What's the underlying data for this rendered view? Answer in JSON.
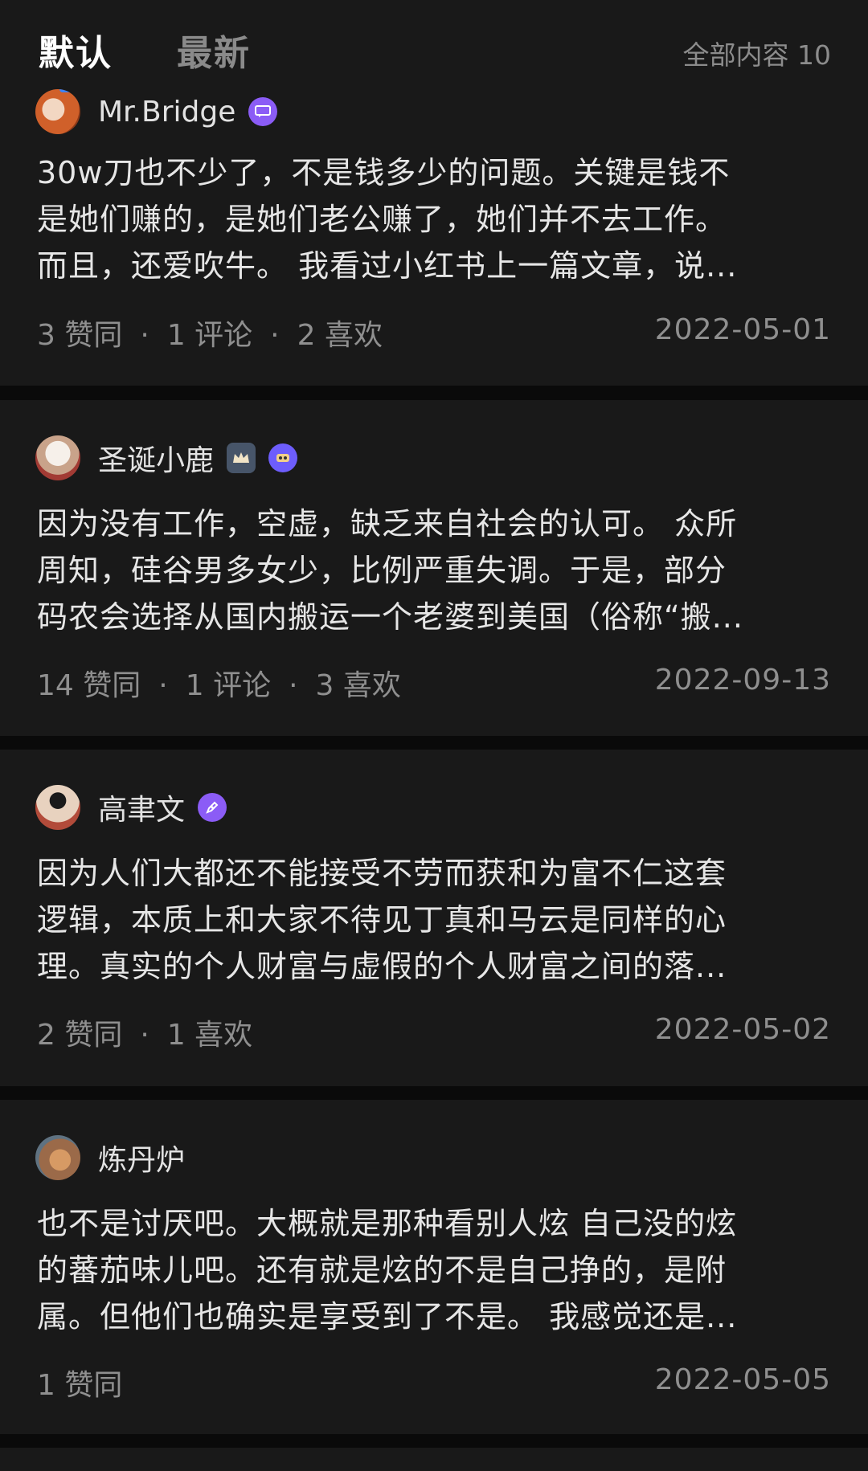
{
  "tabs": {
    "default_label": "默认",
    "latest_label": "最新",
    "total_label": "全部内容 10"
  },
  "answers": [
    {
      "username": "Mr.Bridge",
      "lines": [
        "30w刀也不少了，不是钱多少的问题。关键是钱不",
        "是她们赚的，是她们老公赚了，她们并不去工作。",
        "而且，还爱吹牛。 我看过小红书上一篇文章，说..."
      ],
      "stats": [
        "3 赞同",
        "1 评论",
        "2 喜欢"
      ],
      "date": "2022-05-01"
    },
    {
      "username": "圣诞小鹿",
      "lines": [
        "因为没有工作，空虚，缺乏来自社会的认可。 众所",
        "周知，硅谷男多女少，比例严重失调。于是，部分",
        "码农会选择从国内搬运一个老婆到美国（俗称“搬..."
      ],
      "stats": [
        "14 赞同",
        "1 评论",
        "3 喜欢"
      ],
      "date": "2022-09-13"
    },
    {
      "username": "高聿文",
      "lines": [
        "因为人们大都还不能接受不劳而获和为富不仁这套",
        "逻辑，本质上和大家不待见丁真和马云是同样的心",
        "理。真实的个人财富与虚假的个人财富之间的落..."
      ],
      "stats": [
        "2 赞同",
        "1 喜欢"
      ],
      "date": "2022-05-02"
    },
    {
      "username": "炼丹炉",
      "lines": [
        "也不是讨厌吧。大概就是那种看别人炫 自己没的炫",
        "的蕃茄味儿吧。还有就是炫的不是自己挣的，是附",
        "属。但他们也确实是享受到了不是。 我感觉还是..."
      ],
      "stats": [
        "1 赞同"
      ],
      "date": "2022-05-05"
    }
  ],
  "stat_separator": "·",
  "icons": {
    "badge_0": "chat-badge-icon",
    "badge_1a": "crown-badge-icon",
    "badge_1b": "creator-badge-icon",
    "badge_2": "pen-badge-icon"
  },
  "colors": {
    "background": "#0a0a0a",
    "card": "#191919",
    "text": "#e6e6e6",
    "muted": "#8f8f8f",
    "badge_purple": "#8b5cf6"
  }
}
